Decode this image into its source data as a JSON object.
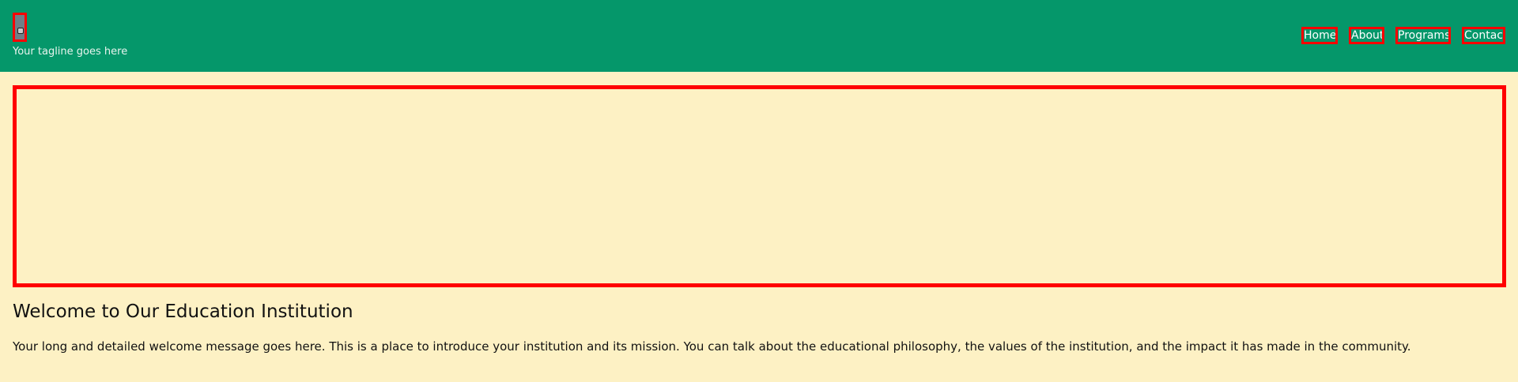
{
  "header": {
    "tagline": "Your tagline goes here",
    "logo_icon": "logo-image-icon",
    "background_color": "#05976a"
  },
  "nav": {
    "items": [
      {
        "label": "Home"
      },
      {
        "label": "About"
      },
      {
        "label": "Programs"
      },
      {
        "label": "Contact"
      }
    ]
  },
  "main": {
    "welcome_title": "Welcome to Our Education Institution",
    "welcome_text": "Your long and detailed welcome message goes here. This is a place to introduce your institution and its mission. You can talk about the educational philosophy, the values of the institution, and the impact it has made in the community."
  },
  "colors": {
    "accent": "#ff0000",
    "page_background": "#fdf1c4"
  }
}
